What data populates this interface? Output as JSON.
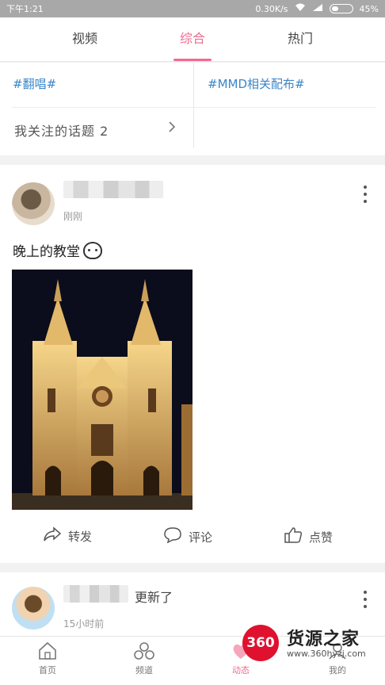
{
  "status_bar": {
    "time": "下午1:21",
    "speed": "0.30K/s",
    "battery": "45%"
  },
  "tabs": [
    {
      "label": "视频",
      "active": false
    },
    {
      "label": "综合",
      "active": true
    },
    {
      "label": "热门",
      "active": false
    }
  ],
  "topics": {
    "left": "#翻唱#",
    "right": "#MMD相关配布#",
    "followed": "我关注的话题 2"
  },
  "posts": [
    {
      "time": "刚刚",
      "text": "晚上的教堂",
      "actions": {
        "share": "转发",
        "comment": "评论",
        "like": "点赞"
      }
    },
    {
      "update": "更新了",
      "time": "15小时前"
    }
  ],
  "bottom_nav": [
    {
      "label": "首页",
      "icon": "home-icon"
    },
    {
      "label": "频道",
      "icon": "channel-icon"
    },
    {
      "label": "动态",
      "icon": "moments-icon",
      "active": true
    },
    {
      "label": "我的",
      "icon": "profile-icon"
    }
  ],
  "watermark": {
    "badge": "360",
    "title": "货源之家",
    "url": "www.360hyzj.com"
  },
  "colors": {
    "accent": "#f06b8f",
    "topic": "#3a86c8",
    "watermark_red": "#e0112f"
  }
}
